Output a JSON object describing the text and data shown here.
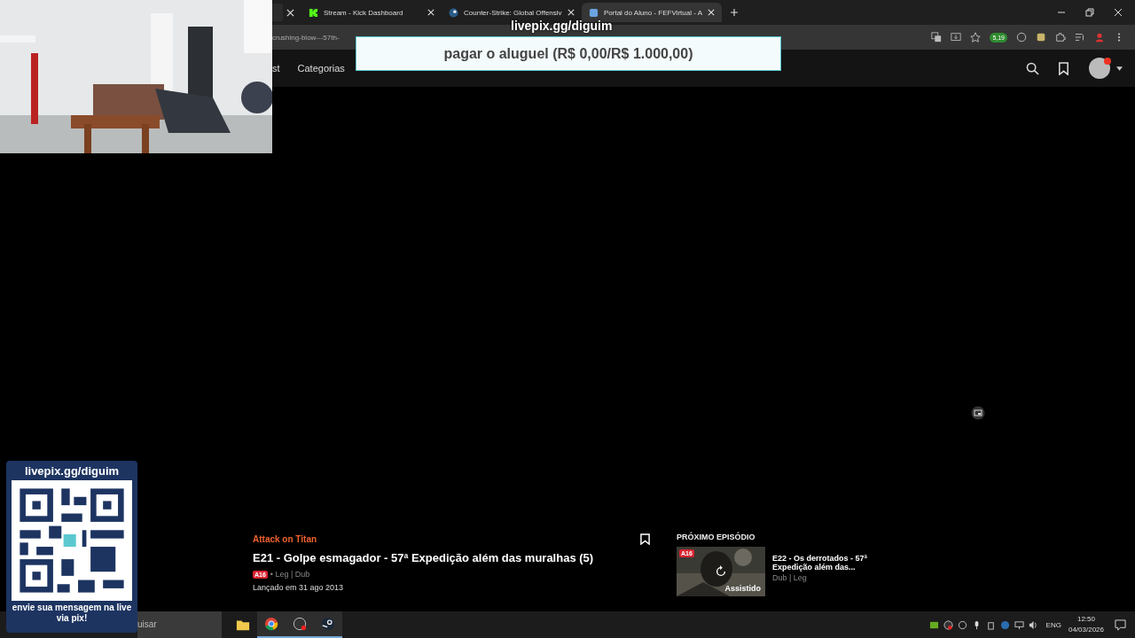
{
  "tabs": [
    {
      "label": "Stream - Kick Dashboard",
      "kind": "kick",
      "selected": false
    },
    {
      "label": "Counter-Strike: Global Offensiv",
      "kind": "steam",
      "selected": false
    },
    {
      "label": "Portal do Aluno - FEFVirtual - A",
      "kind": "portal",
      "selected": true
    }
  ],
  "address": {
    "value": "crushing-blow---57th-",
    "extension_badge": "5,19"
  },
  "nav": {
    "items": [
      "st",
      "Categorias"
    ]
  },
  "banner": {
    "url": "livepix.gg/diguim",
    "goal": "pagar o aluguel (R$ 0,00/R$ 1.000,00)"
  },
  "qr_card": {
    "url": "livepix.gg/diguim",
    "message": "envie sua mensagem na live via pix!"
  },
  "episode": {
    "series": "Attack on Titan",
    "title": "E21 - Golpe esmagador - 57ª Expedição além das muralhas (5)",
    "rating": "A16",
    "audio": "• Leg | Dub",
    "released": "Lançado em 31 ago 2013",
    "bookmarked": false
  },
  "next": {
    "heading": "PRÓXIMO EPISÓDIO",
    "rating": "A16",
    "status": "Assistido",
    "title": "E22 - Os derrotados - 57ª Expedição além das...",
    "audio": "Dub | Leg"
  },
  "taskbar": {
    "search": "uisar",
    "apps": [
      {
        "kind": "folder",
        "selected": false
      },
      {
        "kind": "chrome",
        "selected": true
      },
      {
        "kind": "obs",
        "selected": true
      },
      {
        "kind": "steam",
        "selected": true
      }
    ],
    "lang": "ENG",
    "time": "12:50",
    "date": "04/03/2026"
  }
}
